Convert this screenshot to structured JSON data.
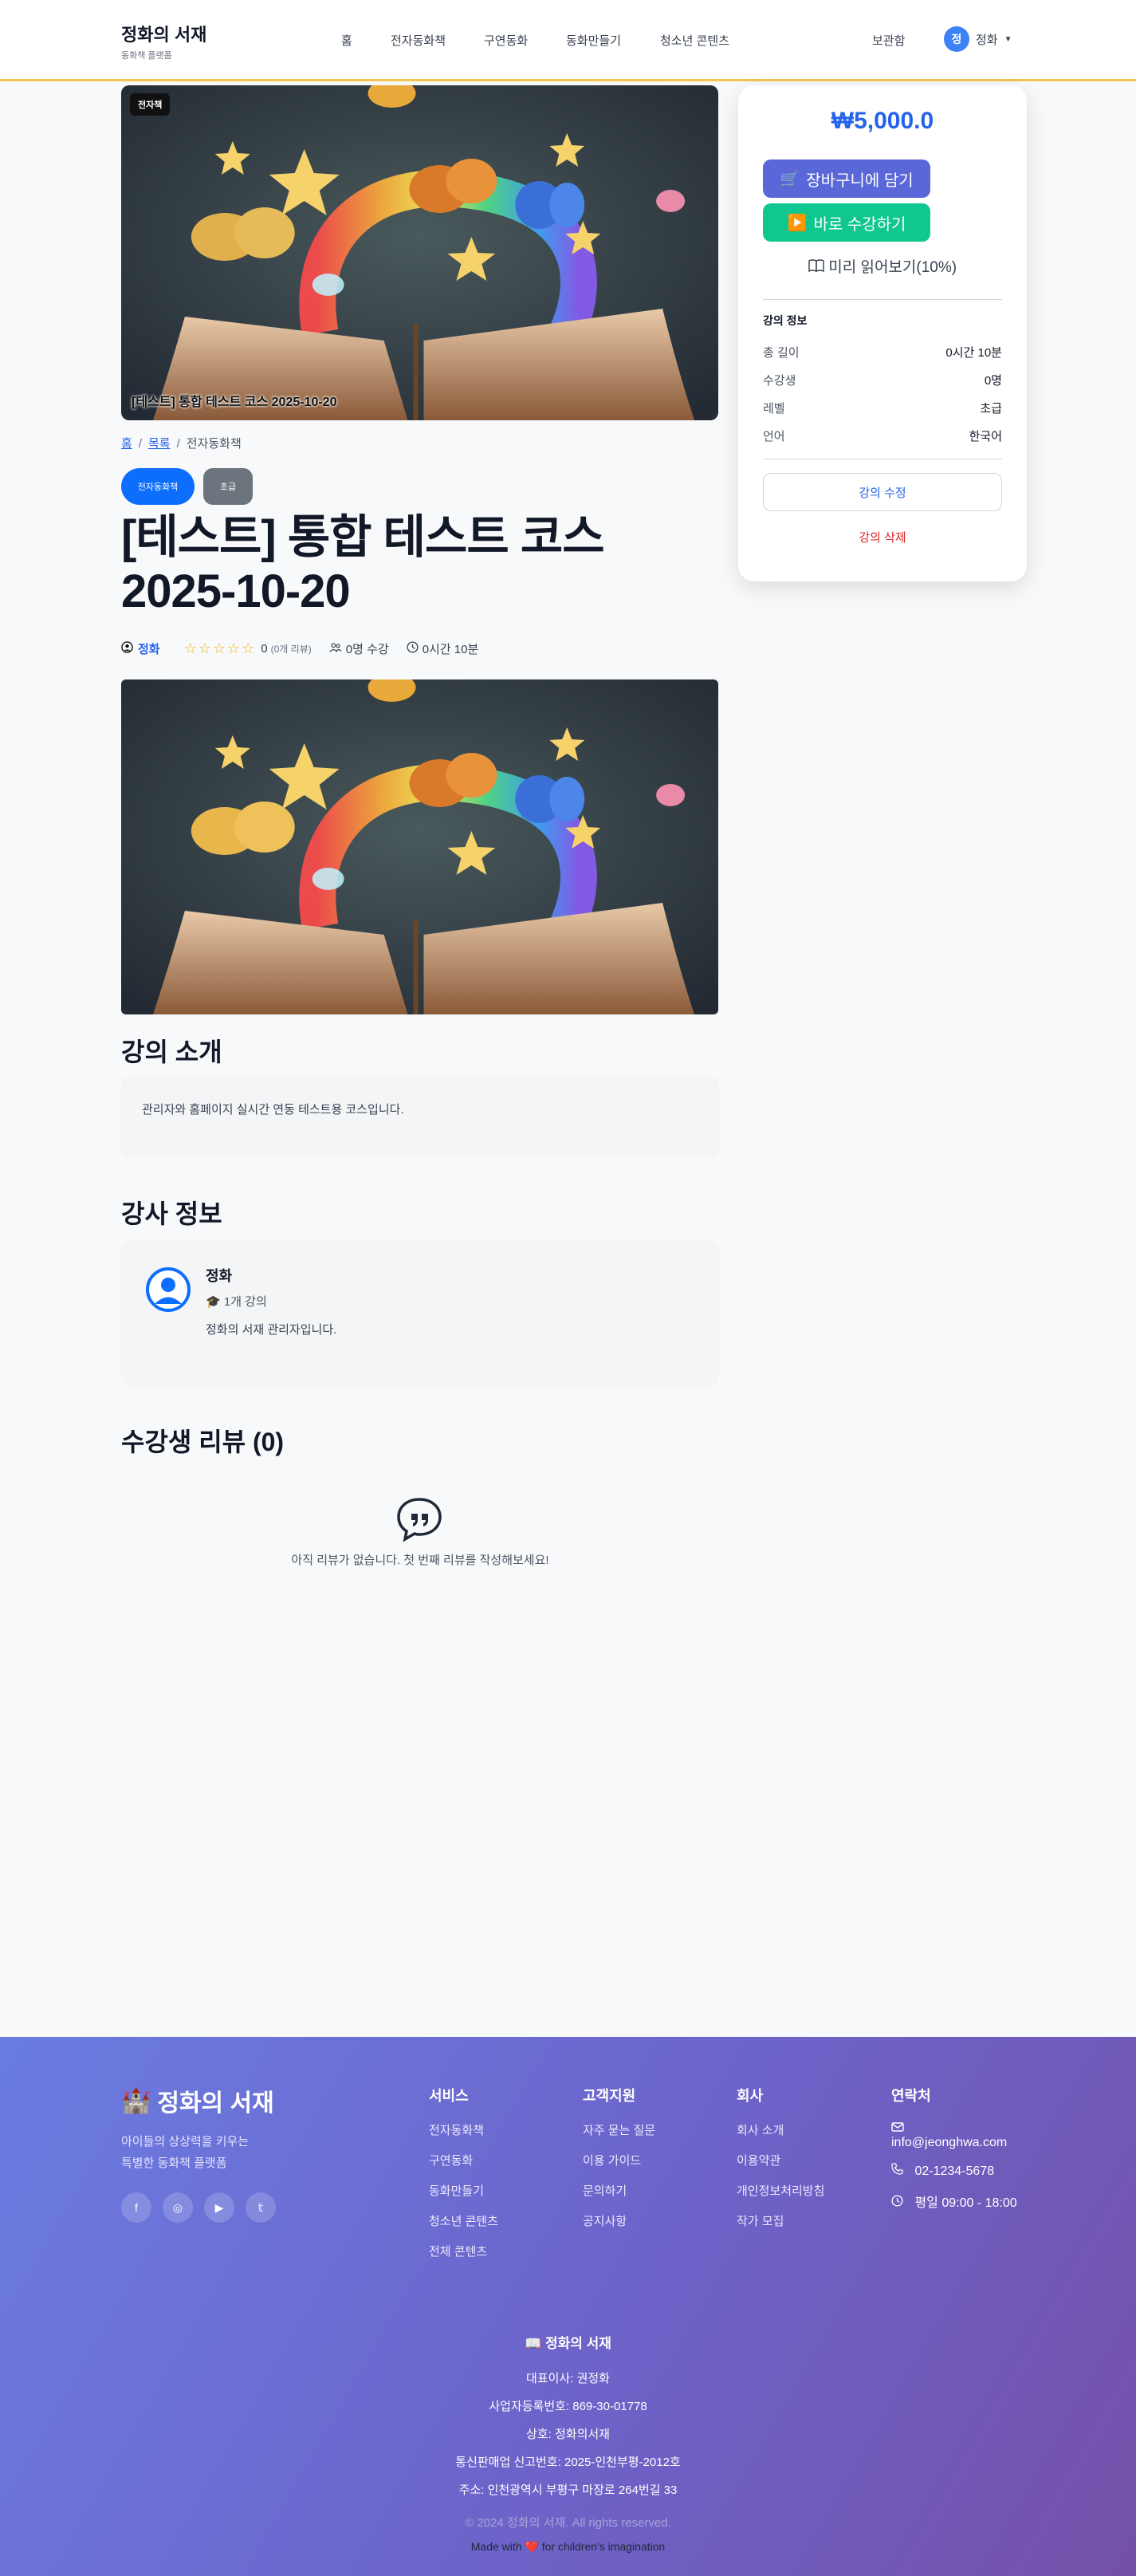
{
  "header": {
    "brand": "정화의 서재",
    "brand_sub": "동화책 플랫폼",
    "nav": [
      "홈",
      "전자동화책",
      "구연동화",
      "동화만들기",
      "청소년 콘텐츠"
    ],
    "bookmark": "보관함",
    "user_initial": "정",
    "user_name": "정화"
  },
  "hero": {
    "badge": "전자책",
    "caption": "[테스트] 통합 테스트 코스 2025-10-20"
  },
  "breadcrumb": {
    "home": "홈",
    "list": "목록",
    "current": "전자동화책"
  },
  "tags": {
    "category": "전자동화책",
    "level": "초급"
  },
  "course": {
    "title": "[테스트] 통합 테스트 코스 2025-10-20",
    "instructor": "정화",
    "stars": "☆☆☆☆☆",
    "rating": "0",
    "review_count": "(0개 리뷰)",
    "students": "0명 수강",
    "duration": "0시간 10분"
  },
  "intro": {
    "heading": "강의 소개",
    "text": "관리자와 홈페이지 실시간 연동 테스트용 코스입니다."
  },
  "instructor": {
    "heading": "강사 정보",
    "name": "정화",
    "courses": "1개 강의",
    "bio": "정화의 서재 관리자입니다."
  },
  "reviews": {
    "heading": "수강생 리뷰 (0)",
    "empty": "아직 리뷰가 없습니다. 첫 번째 리뷰를 작성해보세요!"
  },
  "sidebar": {
    "price": "₩5,000.0",
    "cart": "장바구니에 담기",
    "buy_now": "바로 수강하기",
    "preview": "미리 읽어보기(10%)",
    "info_title": "강의 정보",
    "rows": [
      {
        "k": "총 길이",
        "v": "0시간 10분"
      },
      {
        "k": "수강생",
        "v": "0명"
      },
      {
        "k": "레벨",
        "v": "초급"
      },
      {
        "k": "언어",
        "v": "한국어"
      }
    ],
    "edit": "강의 수정",
    "delete": "강의 삭제"
  },
  "footer": {
    "brand": "정화의 서재",
    "desc1": "아이들의 상상력을 키우는",
    "desc2": "특별한 동화책 플랫폼",
    "services": {
      "title": "서비스",
      "links": [
        "전자동화책",
        "구연동화",
        "동화만들기",
        "청소년 콘텐츠",
        "전체 콘텐츠"
      ]
    },
    "support": {
      "title": "고객지원",
      "links": [
        "자주 묻는 질문",
        "이용 가이드",
        "문의하기",
        "공지사항"
      ]
    },
    "company": {
      "title": "회사",
      "links": [
        "회사 소개",
        "이용약관",
        "개인정보처리방침",
        "작가 모집"
      ]
    },
    "contact": {
      "title": "연락처",
      "email": "info@jeonghwa.com",
      "phone": "02-1234-5678",
      "hours": "평일 09:00 - 18:00"
    },
    "bottom_brand": "정화의 서재",
    "ceo": "대표이사: 권정화",
    "bizno": "사업자등록번호: 869-30-01778",
    "trade": "상호: 정화의서재",
    "mailorder": "통신판매업 신고번호: 2025-인천부평-2012호",
    "address": "주소: 인천광역시 부평구 마장로 264번길 33",
    "copyright": "© 2024 정화의 서재. All rights reserved.",
    "made_pre": "Made with",
    "made_post": "for children's imagination"
  }
}
